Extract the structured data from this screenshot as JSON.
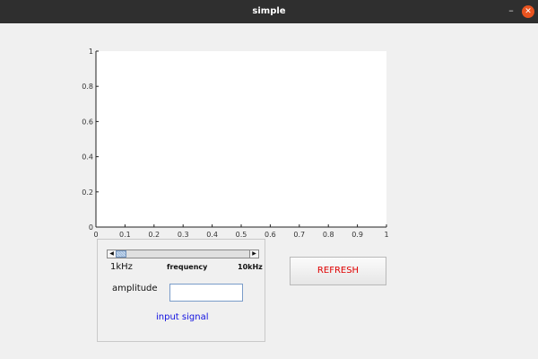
{
  "window": {
    "title": "simple",
    "minimize_glyph": "–",
    "close_glyph": "✕"
  },
  "chart_data": {
    "type": "line",
    "series": [],
    "xlim": [
      0,
      1
    ],
    "ylim": [
      0,
      1
    ],
    "xticks": [
      "0",
      "0.1",
      "0.2",
      "0.3",
      "0.4",
      "0.5",
      "0.6",
      "0.7",
      "0.8",
      "0.9",
      "1"
    ],
    "yticks": [
      "0",
      "0.2",
      "0.4",
      "0.6",
      "0.8",
      "1"
    ],
    "grid": false,
    "title": "",
    "xlabel": "",
    "ylabel": ""
  },
  "controls": {
    "slider": {
      "min_label": "1kHz",
      "center_label": "frequency",
      "max_label": "10kHz",
      "value_fraction": 0.0,
      "left_arrow": "◀",
      "right_arrow": "▶"
    },
    "amplitude": {
      "label": "amplitude",
      "value": ""
    },
    "panel_title": "input signal",
    "refresh_label": "REFRESH"
  },
  "colors": {
    "titlebar": "#2f2f2f",
    "close_button": "#e95420",
    "refresh_text": "#e00000",
    "signal_label": "#1010e0"
  }
}
